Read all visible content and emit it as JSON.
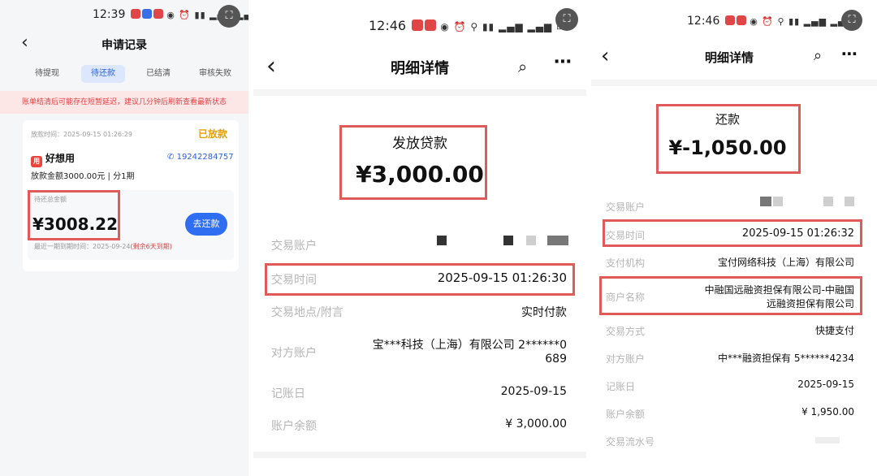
{
  "panel1": {
    "time": "12:39",
    "title": "申请记录",
    "tabs": [
      "待提现",
      "待还款",
      "已结清",
      "审核失败"
    ],
    "banner": "账单结清后可能存在短暂延迟，建议几分钟后刷新查看最新状态",
    "card": {
      "loan_time": "放款时间：2025-09-15 01:26:29",
      "status": "已放款",
      "lender": "好想用",
      "phone": "19242284757",
      "detail": "放款金额3000.00元 | 分1期",
      "due_label": "待还总金额",
      "due_amount": "¥3008.22",
      "repay_button": "去还款",
      "last_due_prefix": "最近一期到期时间：2025-09-24",
      "last_due_suffix": "(剩余6天到期)"
    }
  },
  "panel2": {
    "time": "12:46",
    "title": "明细详情",
    "type": "发放贷款",
    "amount": "¥3,000.00",
    "rows": [
      {
        "label": "交易账户",
        "value": ""
      },
      {
        "label": "交易时间",
        "value": "2025-09-15 01:26:30"
      },
      {
        "label": "交易地点/附言",
        "value": "实时付款"
      },
      {
        "label": "对方账户",
        "value": "宝***科技（上海）有限公司 2******0",
        "value2": "689"
      },
      {
        "label": "记账日",
        "value": "2025-09-15"
      },
      {
        "label": "账户余额",
        "value": "¥ 3,000.00"
      }
    ]
  },
  "panel3": {
    "time": "12:46",
    "title": "明细详情",
    "type": "还款",
    "amount": "¥-1,050.00",
    "rows": [
      {
        "label": "交易账户",
        "value": ""
      },
      {
        "label": "交易时间",
        "value": "2025-09-15 01:26:32"
      },
      {
        "label": "支付机构",
        "value": "宝付网络科技（上海）有限公司"
      },
      {
        "label": "商户名称",
        "value": "中融国远融资担保有限公司-中融国",
        "value2": "远融资担保有限公司"
      },
      {
        "label": "交易方式",
        "value": "快捷支付"
      },
      {
        "label": "对方账户",
        "value": "中***融资担保有 5******4234"
      },
      {
        "label": "记账日",
        "value": "2025-09-15"
      },
      {
        "label": "账户余额",
        "value": "¥ 1,950.00"
      },
      {
        "label": "交易流水号",
        "value": ""
      }
    ]
  },
  "icons": {
    "back": "chevron-left-icon",
    "search": "search-icon",
    "more": "more-icon",
    "screenshot": "screenshot-icon",
    "phone": "phone-icon"
  },
  "colors": {
    "accent": "#2f6ef0",
    "highlight": "#e05a5a",
    "status": "#e8a000",
    "warning": "#e04040"
  }
}
